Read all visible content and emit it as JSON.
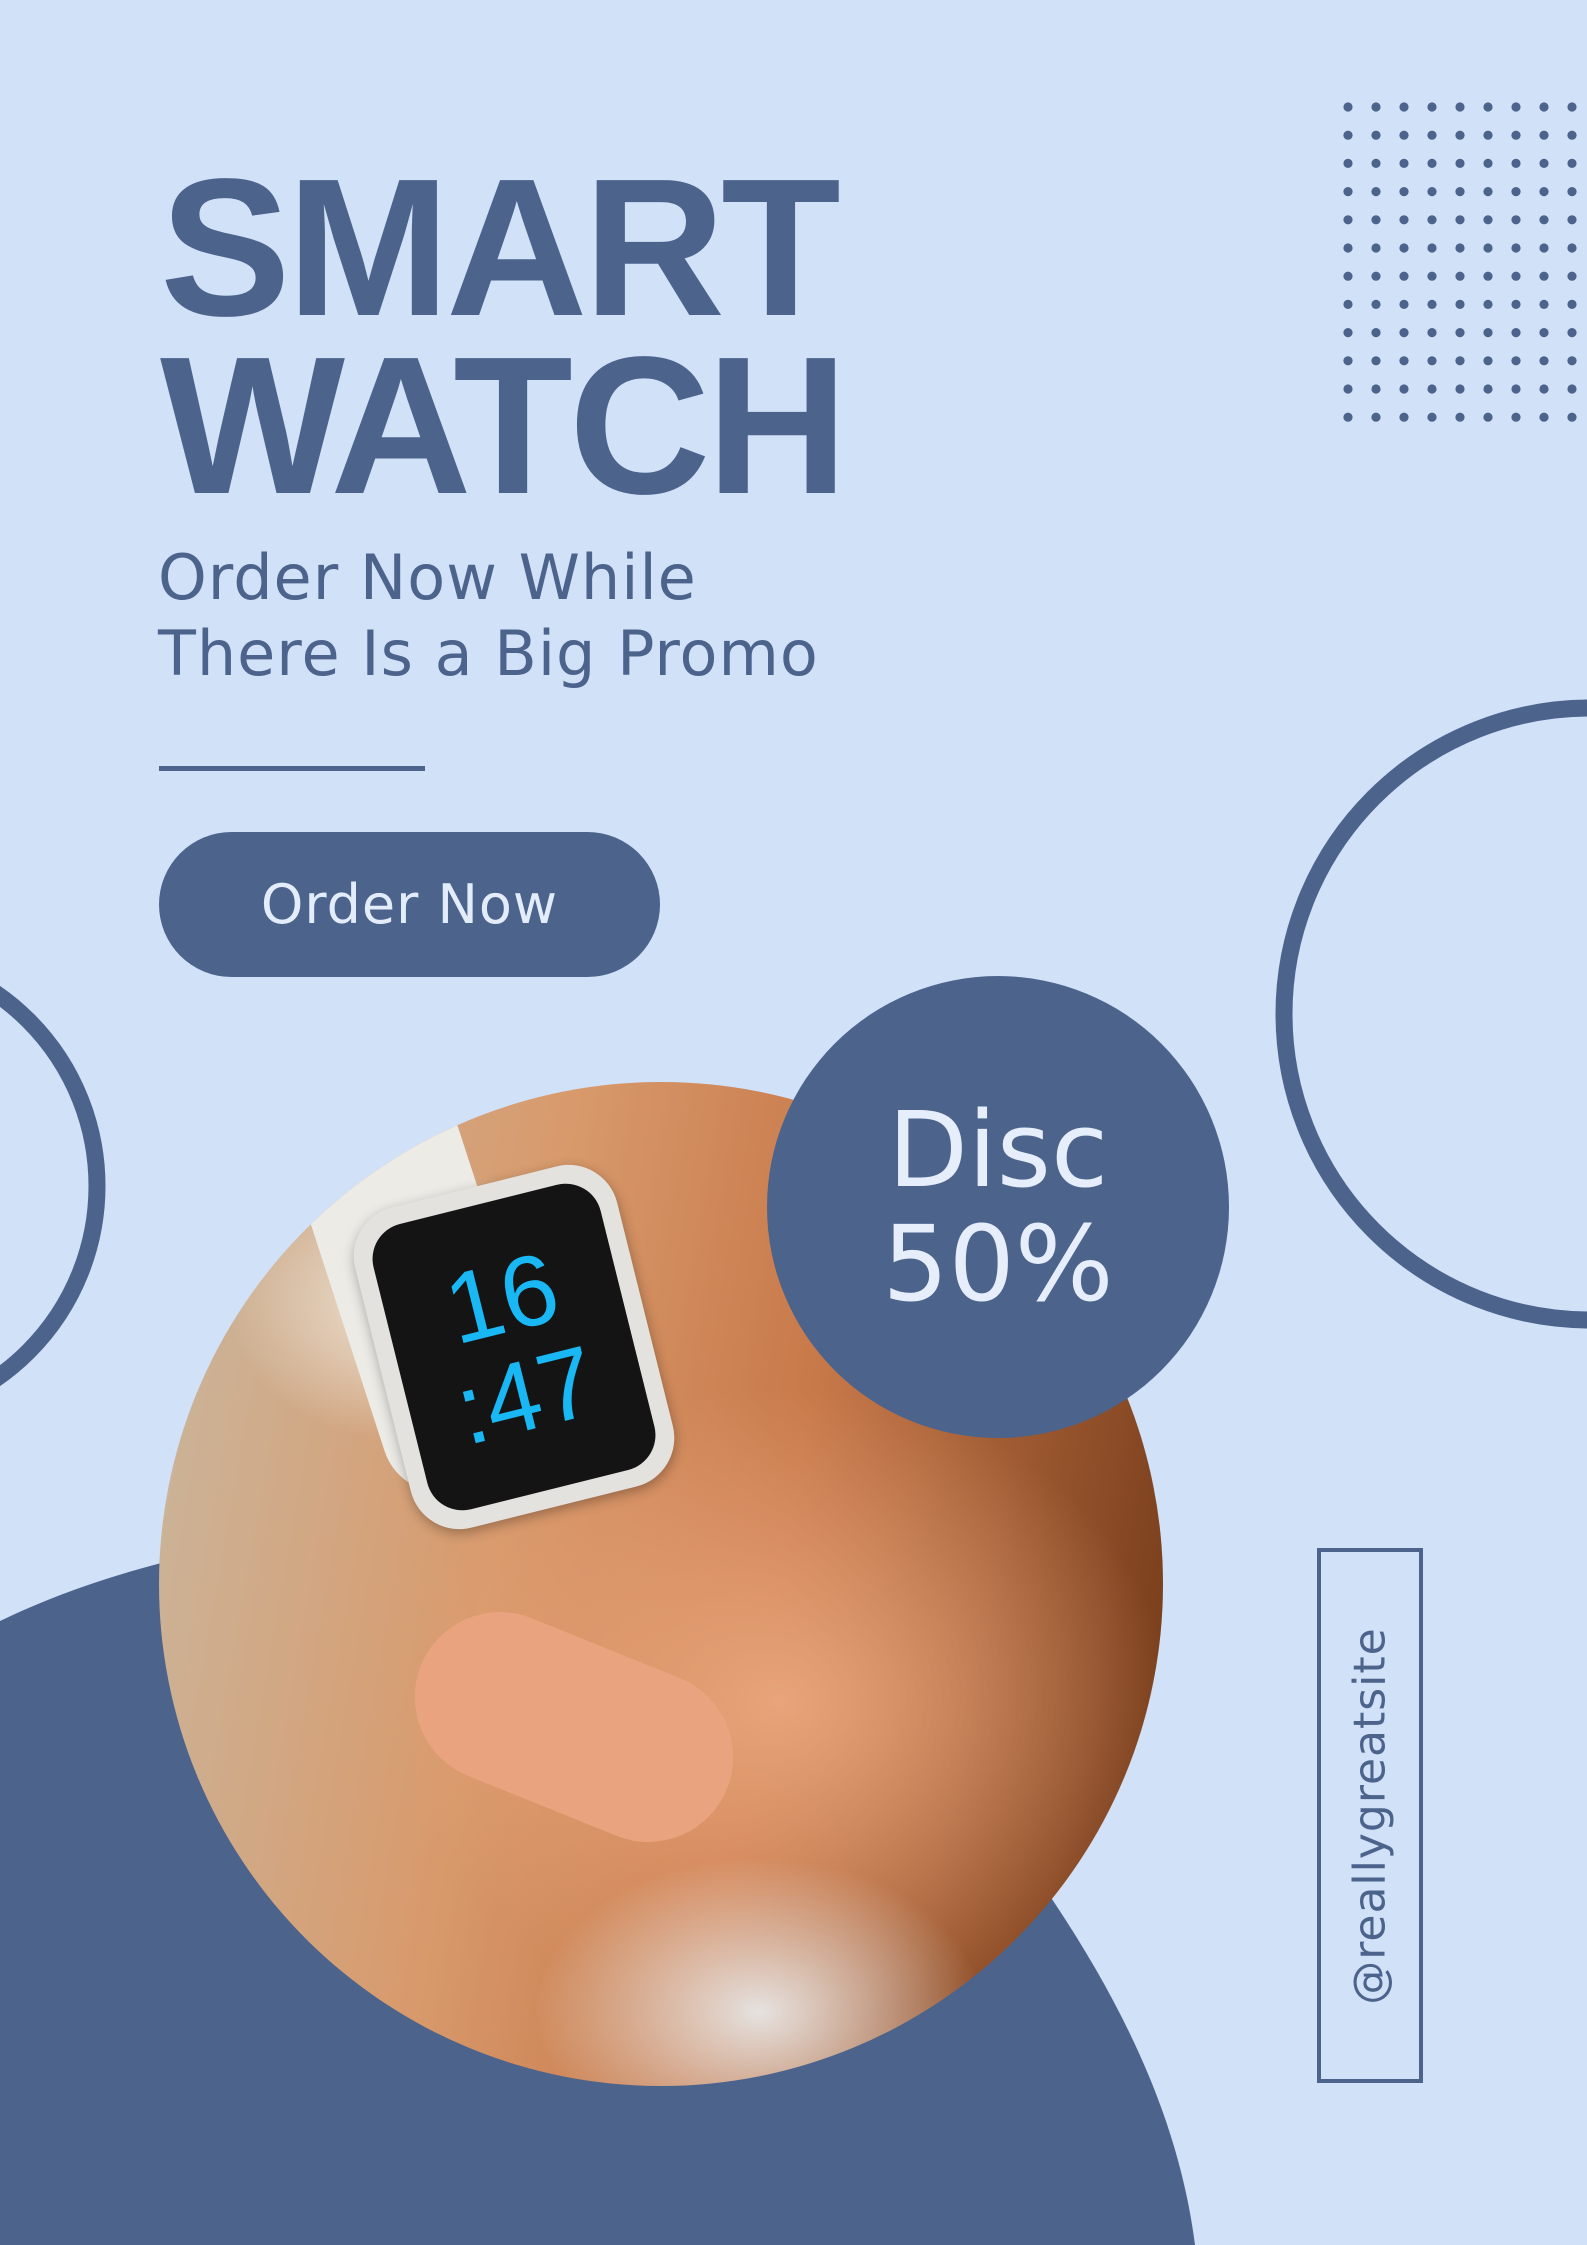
{
  "colors": {
    "background": "#d1e1f8",
    "primary": "#4c638c",
    "light_text": "#e3ecfb",
    "watch_digits": "#19b8f5"
  },
  "header": {
    "title_line1": "SMART",
    "title_line2": "WATCH"
  },
  "subtitle": {
    "line1": "Order Now While",
    "line2": "There Is a Big Promo"
  },
  "cta": {
    "label": "Order Now"
  },
  "discount": {
    "line1": "Disc",
    "line2": "50%"
  },
  "photo": {
    "watch_hours": "16",
    "watch_minutes": ":47"
  },
  "social": {
    "handle": "@reallygreatsite"
  },
  "decor": {
    "dot_grid": "dot-grid-icon",
    "rings": "ring-outline"
  }
}
